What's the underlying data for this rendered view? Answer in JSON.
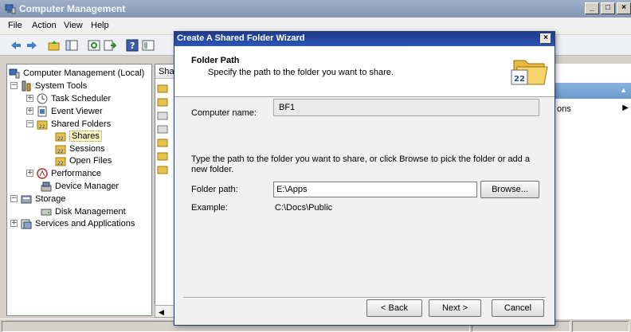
{
  "window": {
    "title": "Computer Management",
    "buttons": [
      "_",
      "□",
      "×"
    ]
  },
  "menu": [
    "File",
    "Action",
    "View",
    "Help"
  ],
  "tree": {
    "items": [
      {
        "label": "Computer Management (Local)"
      },
      {
        "label": "System Tools"
      },
      {
        "label": "Task Scheduler"
      },
      {
        "label": "Event Viewer"
      },
      {
        "label": "Shared Folders"
      },
      {
        "label": "Shares"
      },
      {
        "label": "Sessions"
      },
      {
        "label": "Open Files"
      },
      {
        "label": "Performance"
      },
      {
        "label": "Device Manager"
      },
      {
        "label": "Storage"
      },
      {
        "label": "Disk Management"
      },
      {
        "label": "Services and Applications"
      }
    ]
  },
  "list": {
    "header": "Sha"
  },
  "actions": {
    "row_label": "ons"
  },
  "dialog": {
    "title": "Create A Shared Folder Wizard",
    "close": "×",
    "heading": "Folder Path",
    "subheading": "Specify the path to the folder you want to share.",
    "computer_name_label": "Computer name:",
    "computer_name_value": "BF1",
    "instruction": "Type the path to the folder you want to share, or click Browse to pick the folder or add a new folder.",
    "folder_path_label": "Folder path:",
    "folder_path_value": "E:\\Apps",
    "browse": "Browse...",
    "example_label": "Example:",
    "example_value": "C:\\Docs\\Public",
    "back": "< Back",
    "next": "Next >",
    "cancel": "Cancel"
  },
  "colors": {
    "title_active": "#2c56b8",
    "title_inactive": "#8397b4",
    "actions_header": "#6a98cc",
    "selection": "#fff3c0"
  }
}
